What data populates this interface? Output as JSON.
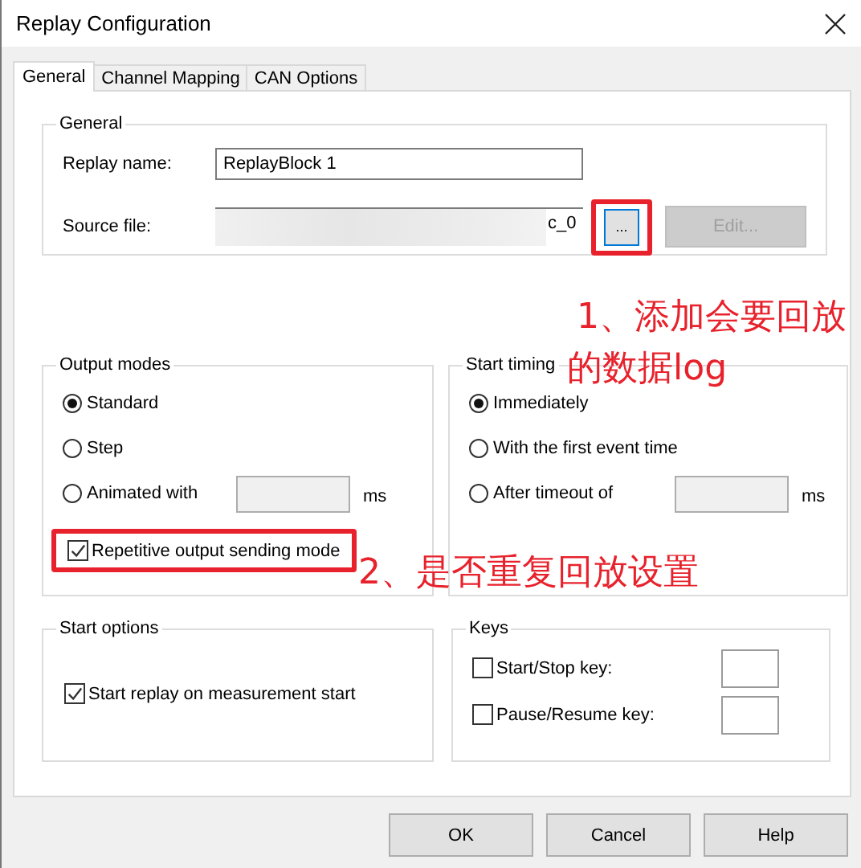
{
  "window": {
    "title": "Replay Configuration"
  },
  "tabs": [
    {
      "label": "General",
      "selected": true
    },
    {
      "label": "Channel Mapping",
      "selected": false
    },
    {
      "label": "CAN Options",
      "selected": false
    }
  ],
  "general": {
    "title": "General",
    "replay_name": {
      "label": "Replay name:",
      "value": "ReplayBlock 1"
    },
    "source_file": {
      "label": "Source file:",
      "value": "c_0",
      "browse_button": {
        "label": "...",
        "highlighted": true
      },
      "edit_button": {
        "label": "Edit...",
        "disabled": true
      }
    }
  },
  "output_modes": {
    "title": "Output modes",
    "options": [
      {
        "label": "Standard",
        "selected": true
      },
      {
        "label": "Step",
        "selected": false
      },
      {
        "label": "Animated with",
        "selected": false,
        "unit": "ms"
      }
    ],
    "repetitive": {
      "label": "Repetitive output sending mode",
      "checked": true,
      "highlighted": true
    }
  },
  "start_timing": {
    "title": "Start timing",
    "options": [
      {
        "label": "Immediately",
        "selected": true
      },
      {
        "label": "With the first event time",
        "selected": false
      },
      {
        "label": "After timeout of",
        "selected": false,
        "unit": "ms"
      }
    ]
  },
  "start_options": {
    "title": "Start options",
    "checkboxes": [
      {
        "label": "Start replay on measurement start",
        "checked": true
      }
    ]
  },
  "keys": {
    "title": "Keys",
    "items": [
      {
        "label": "Start/Stop key:",
        "checked": false
      },
      {
        "label": "Pause/Resume key:",
        "checked": false
      }
    ]
  },
  "buttons": [
    {
      "label": "OK"
    },
    {
      "label": "Cancel"
    },
    {
      "label": "Help"
    }
  ],
  "annotations": [
    {
      "lines": [
        "1、添加会要回放",
        "的数据log"
      ]
    },
    {
      "lines": [
        "2、是否重复回放设置"
      ]
    }
  ]
}
